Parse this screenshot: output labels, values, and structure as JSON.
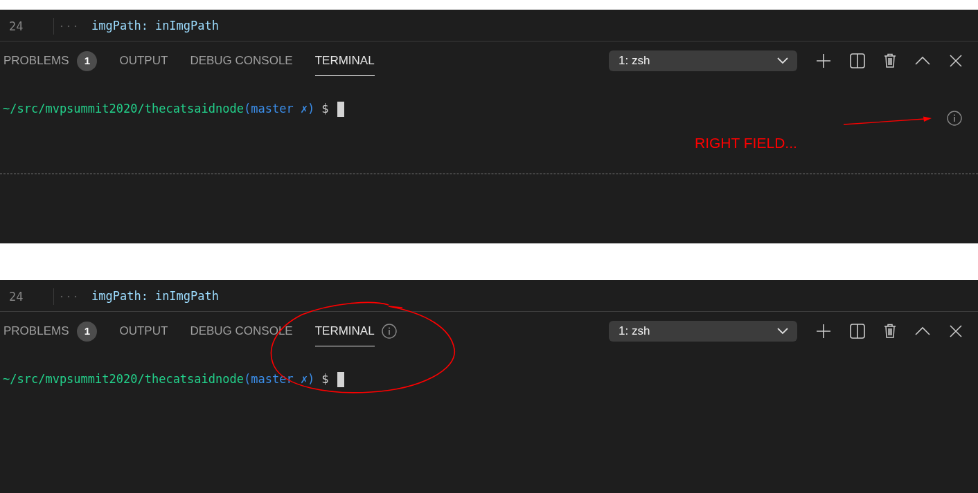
{
  "panels": [
    {
      "editor_lines": [
        {
          "number": "24",
          "tokens": [
            {
              "kind": "key",
              "text": "imgPath:"
            },
            {
              "kind": "key",
              "text": "inImgPath"
            }
          ]
        }
      ],
      "tabs": [
        {
          "label": "PROBLEMS",
          "badge": "1",
          "selected": false,
          "info_icon": false
        },
        {
          "label": "OUTPUT",
          "selected": false,
          "info_icon": false
        },
        {
          "label": "DEBUG CONSOLE",
          "selected": false,
          "info_icon": false
        },
        {
          "label": "TERMINAL",
          "selected": true,
          "info_icon": false
        }
      ],
      "terminal_selector": "1: zsh",
      "prompt": [
        {
          "kind": "path",
          "text": "~/src/mvpsummit2020/thecatsaidnode"
        },
        {
          "kind": "branch",
          "text": "(master ✗)"
        },
        {
          "kind": "symbol",
          "text": "$"
        }
      ],
      "right_info_icon": true,
      "dashed_divider": true,
      "annotation": {
        "kind": "arrow-note",
        "text": "RIGHT FIELD..."
      }
    },
    {
      "editor_lines": [
        {
          "number": "24",
          "tokens": [
            {
              "kind": "key",
              "text": "imgPath:"
            },
            {
              "kind": "key",
              "text": "inImgPath"
            }
          ]
        }
      ],
      "tabs": [
        {
          "label": "PROBLEMS",
          "badge": "1",
          "selected": false,
          "info_icon": false
        },
        {
          "label": "OUTPUT",
          "selected": false,
          "info_icon": false
        },
        {
          "label": "DEBUG CONSOLE",
          "selected": false,
          "info_icon": false
        },
        {
          "label": "TERMINAL",
          "selected": true,
          "info_icon": true
        }
      ],
      "terminal_selector": "1: zsh",
      "prompt": [
        {
          "kind": "path",
          "text": "~/src/mvpsummit2020/thecatsaidnode"
        },
        {
          "kind": "branch",
          "text": "(master ✗)"
        },
        {
          "kind": "symbol",
          "text": "$"
        }
      ],
      "right_info_icon": false,
      "dashed_divider": false,
      "annotation": {
        "kind": "circle"
      }
    }
  ]
}
